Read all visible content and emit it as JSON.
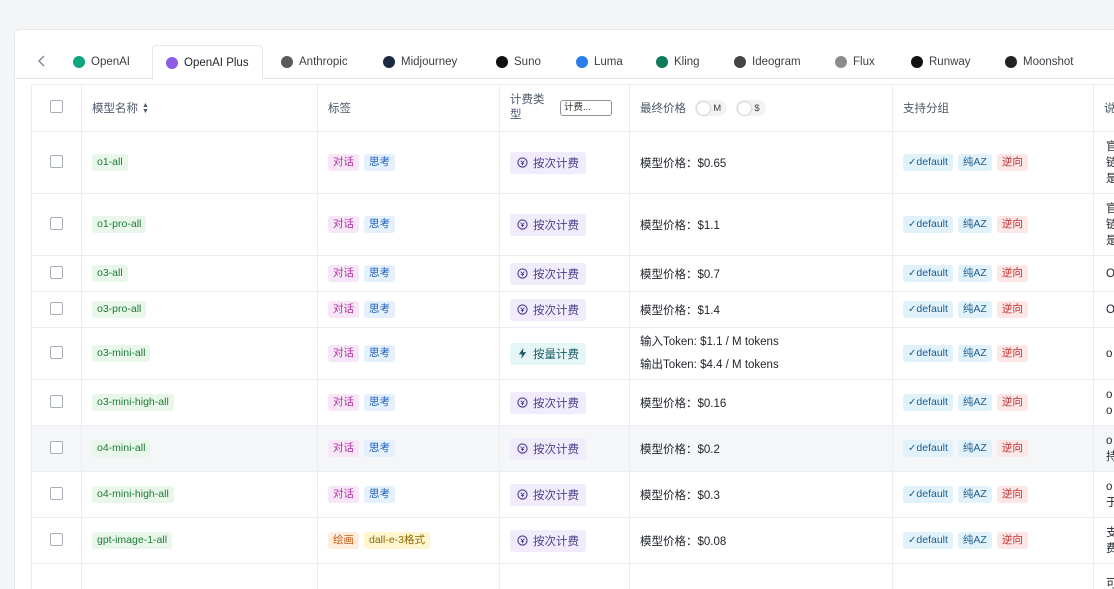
{
  "tabs": [
    {
      "label": "OpenAI",
      "icon": "openai-icon",
      "color": "#10a37f"
    },
    {
      "label": "OpenAI Plus",
      "icon": "openai-plus-icon",
      "color": "#8e5be6"
    },
    {
      "label": "Anthropic",
      "icon": "anthropic-icon",
      "color": "#5a5a5a"
    },
    {
      "label": "Midjourney",
      "icon": "midjourney-icon",
      "color": "#1b2a41"
    },
    {
      "label": "Suno",
      "icon": "suno-icon",
      "color": "#111111"
    },
    {
      "label": "Luma",
      "icon": "luma-icon",
      "color": "#2b7de9"
    },
    {
      "label": "Kling",
      "icon": "kling-icon",
      "color": "#0d7a5c"
    },
    {
      "label": "Ideogram",
      "icon": "ideogram-icon",
      "color": "#444444"
    },
    {
      "label": "Flux",
      "icon": "flux-icon",
      "color": "#8c8c8c"
    },
    {
      "label": "Runway",
      "icon": "runway-icon",
      "color": "#111111"
    },
    {
      "label": "Moonshot",
      "icon": "moonshot-icon",
      "color": "#222222"
    }
  ],
  "table": {
    "headers": {
      "name": "模型名称",
      "tags": "标签",
      "billing": "计费类型",
      "billing_filter": "计费...",
      "price": "最终价格",
      "toggle_m": "M",
      "toggle_usd": "$",
      "groups": "支持分组",
      "desc": "说"
    },
    "rows": [
      {
        "name": "o1-all",
        "tags": [
          "对话",
          "思考"
        ],
        "billing": "按次计费",
        "price": "模型价格：$0.65",
        "groups": [
          "default",
          "纯AZ",
          "逆向"
        ],
        "desc": "官\n链\n是"
      },
      {
        "name": "o1-pro-all",
        "tags": [
          "对话",
          "思考"
        ],
        "billing": "按次计费",
        "price": "模型价格：$1.1",
        "groups": [
          "default",
          "纯AZ",
          "逆向"
        ],
        "desc": "官\n链\n是"
      },
      {
        "name": "o3-all",
        "tags": [
          "对话",
          "思考"
        ],
        "billing": "按次计费",
        "price": "模型价格：$0.7",
        "groups": [
          "default",
          "纯AZ",
          "逆向"
        ],
        "desc": "O"
      },
      {
        "name": "o3-pro-all",
        "tags": [
          "对话",
          "思考"
        ],
        "billing": "按次计费",
        "price": "模型价格：$1.4",
        "groups": [
          "default",
          "纯AZ",
          "逆向"
        ],
        "desc": "O"
      },
      {
        "name": "o3-mini-all",
        "tags": [
          "对话",
          "思考"
        ],
        "billing": "按量计费",
        "price_in": "输入Token: $1.1 / M tokens",
        "price_out": "输出Token: $4.4 / M tokens",
        "groups": [
          "default",
          "纯AZ",
          "逆向"
        ],
        "desc": "o"
      },
      {
        "name": "o3-mini-high-all",
        "tags": [
          "对话",
          "思考"
        ],
        "billing": "按次计费",
        "price": "模型价格：$0.16",
        "groups": [
          "default",
          "纯AZ",
          "逆向"
        ],
        "desc": "o\no"
      },
      {
        "name": "o4-mini-all",
        "tags": [
          "对话",
          "思考"
        ],
        "billing": "按次计费",
        "price": "模型价格：$0.2",
        "groups": [
          "default",
          "纯AZ",
          "逆向"
        ],
        "desc": "o\n持"
      },
      {
        "name": "o4-mini-high-all",
        "tags": [
          "对话",
          "思考"
        ],
        "billing": "按次计费",
        "price": "模型价格：$0.3",
        "groups": [
          "default",
          "纯AZ",
          "逆向"
        ],
        "desc": "o\n于"
      },
      {
        "name": "gpt-image-1-all",
        "tags": [
          "绘画",
          "dall-e-3格式"
        ],
        "billing": "按次计费",
        "price": "模型价格：$0.08",
        "groups": [
          "default",
          "纯AZ",
          "逆向"
        ],
        "desc": "支\n费"
      },
      {
        "name": "",
        "tags": [],
        "billing": "",
        "price": "",
        "groups": [],
        "desc": "可"
      }
    ]
  },
  "colors": {
    "border": "#ebedf0",
    "accent": "#8e5be6",
    "tag_name_bg": "#e8f7ea",
    "tag_chat_bg": "#f7e6f7",
    "tag_think_bg": "#e5f0fd",
    "billing_per_call_bg": "#f0ecfb",
    "billing_usage_bg": "#e6f6f7"
  }
}
